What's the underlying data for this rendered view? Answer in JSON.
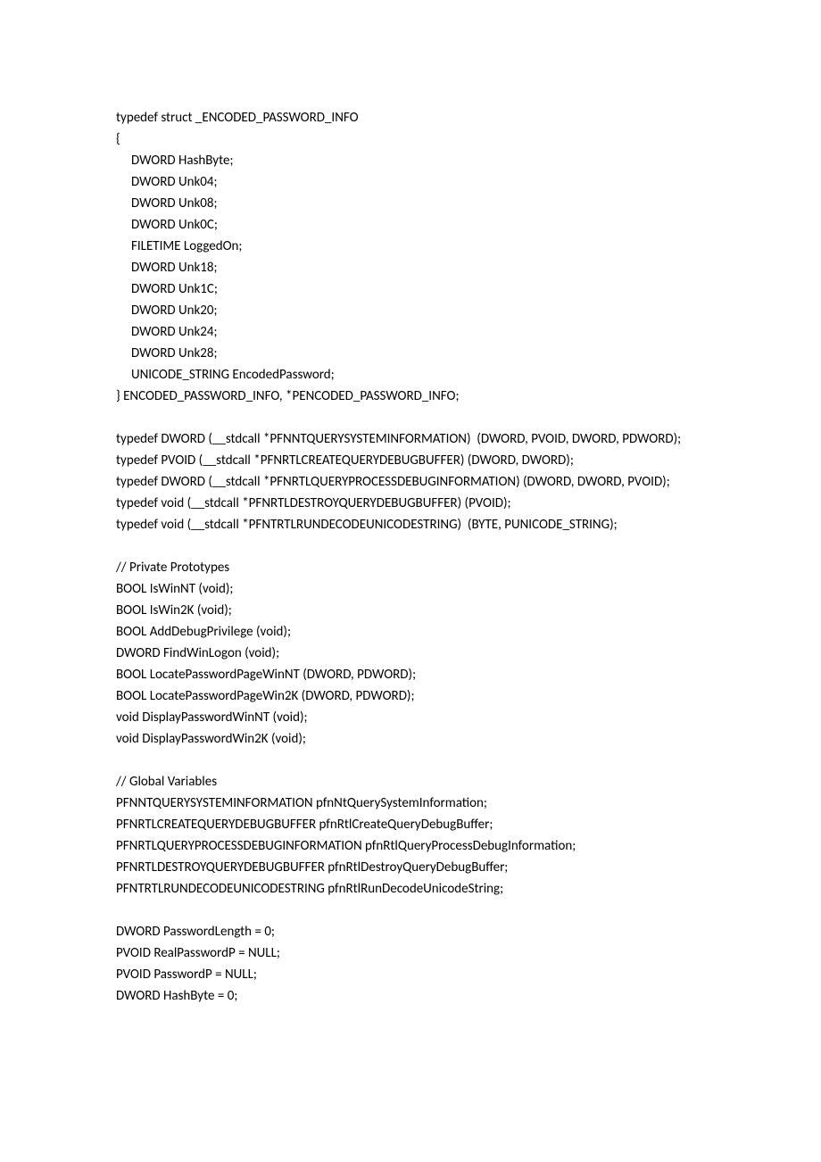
{
  "lines": [
    {
      "text": "typedef struct _ENCODED_PASSWORD_INFO",
      "justify": false
    },
    {
      "text": "{",
      "justify": false
    },
    {
      "text": "     DWORD HashByte;",
      "justify": false
    },
    {
      "text": "     DWORD Unk04;",
      "justify": false
    },
    {
      "text": "     DWORD Unk08;",
      "justify": false
    },
    {
      "text": "     DWORD Unk0C;",
      "justify": false
    },
    {
      "text": "     FILETIME LoggedOn;",
      "justify": false
    },
    {
      "text": "     DWORD Unk18;",
      "justify": false
    },
    {
      "text": "     DWORD Unk1C;",
      "justify": false
    },
    {
      "text": "     DWORD Unk20;",
      "justify": false
    },
    {
      "text": "     DWORD Unk24;",
      "justify": false
    },
    {
      "text": "     DWORD Unk28;",
      "justify": false
    },
    {
      "text": "     UNICODE_STRING EncodedPassword;",
      "justify": false
    },
    {
      "text": "} ENCODED_PASSWORD_INFO, *PENCODED_PASSWORD_INFO;",
      "justify": false
    },
    {
      "blank": true
    },
    {
      "text": "typedef DWORD (__stdcall *PFNNTQUERYSYSTEMINFORMATION)  (DWORD, PVOID, DWORD, PDWORD);",
      "justify": true
    },
    {
      "text": "typedef PVOID (__stdcall *PFNRTLCREATEQUERYDEBUGBUFFER) (DWORD, DWORD);",
      "justify": false
    },
    {
      "text": "typedef DWORD (__stdcall *PFNRTLQUERYPROCESSDEBUGINFORMATION) (DWORD, DWORD, PVOID);",
      "justify": true
    },
    {
      "text": "typedef void (__stdcall *PFNRTLDESTROYQUERYDEBUGBUFFER) (PVOID);",
      "justify": false
    },
    {
      "text": "typedef void (__stdcall *PFNTRTLRUNDECODEUNICODESTRING)  (BYTE, PUNICODE_STRING);",
      "justify": false
    },
    {
      "blank": true
    },
    {
      "text": "// Private Prototypes",
      "justify": false
    },
    {
      "text": "BOOL IsWinNT (void);",
      "justify": false
    },
    {
      "text": "BOOL IsWin2K (void);",
      "justify": false
    },
    {
      "text": "BOOL AddDebugPrivilege (void);",
      "justify": false
    },
    {
      "text": "DWORD FindWinLogon (void);",
      "justify": false
    },
    {
      "text": "BOOL LocatePasswordPageWinNT (DWORD, PDWORD);",
      "justify": false
    },
    {
      "text": "BOOL LocatePasswordPageWin2K (DWORD, PDWORD);",
      "justify": false
    },
    {
      "text": "void DisplayPasswordWinNT (void);",
      "justify": false
    },
    {
      "text": "void DisplayPasswordWin2K (void);",
      "justify": false
    },
    {
      "blank": true
    },
    {
      "text": "// Global Variables",
      "justify": false
    },
    {
      "text": "PFNNTQUERYSYSTEMINFORMATION pfnNtQuerySystemInformation;",
      "justify": false
    },
    {
      "text": "PFNRTLCREATEQUERYDEBUGBUFFER pfnRtlCreateQueryDebugBuffer;",
      "justify": false
    },
    {
      "text": "PFNRTLQUERYPROCESSDEBUGINFORMATION pfnRtlQueryProcessDebugInformation;",
      "justify": false
    },
    {
      "text": "PFNRTLDESTROYQUERYDEBUGBUFFER pfnRtlDestroyQueryDebugBuffer;",
      "justify": false
    },
    {
      "text": "PFNTRTLRUNDECODEUNICODESTRING pfnRtlRunDecodeUnicodeString;",
      "justify": false
    },
    {
      "blank": true
    },
    {
      "text": "DWORD PasswordLength = 0;",
      "justify": false
    },
    {
      "text": "PVOID RealPasswordP = NULL;",
      "justify": false
    },
    {
      "text": "PVOID PasswordP = NULL;",
      "justify": false
    },
    {
      "text": "DWORD HashByte = 0;",
      "justify": false
    }
  ]
}
